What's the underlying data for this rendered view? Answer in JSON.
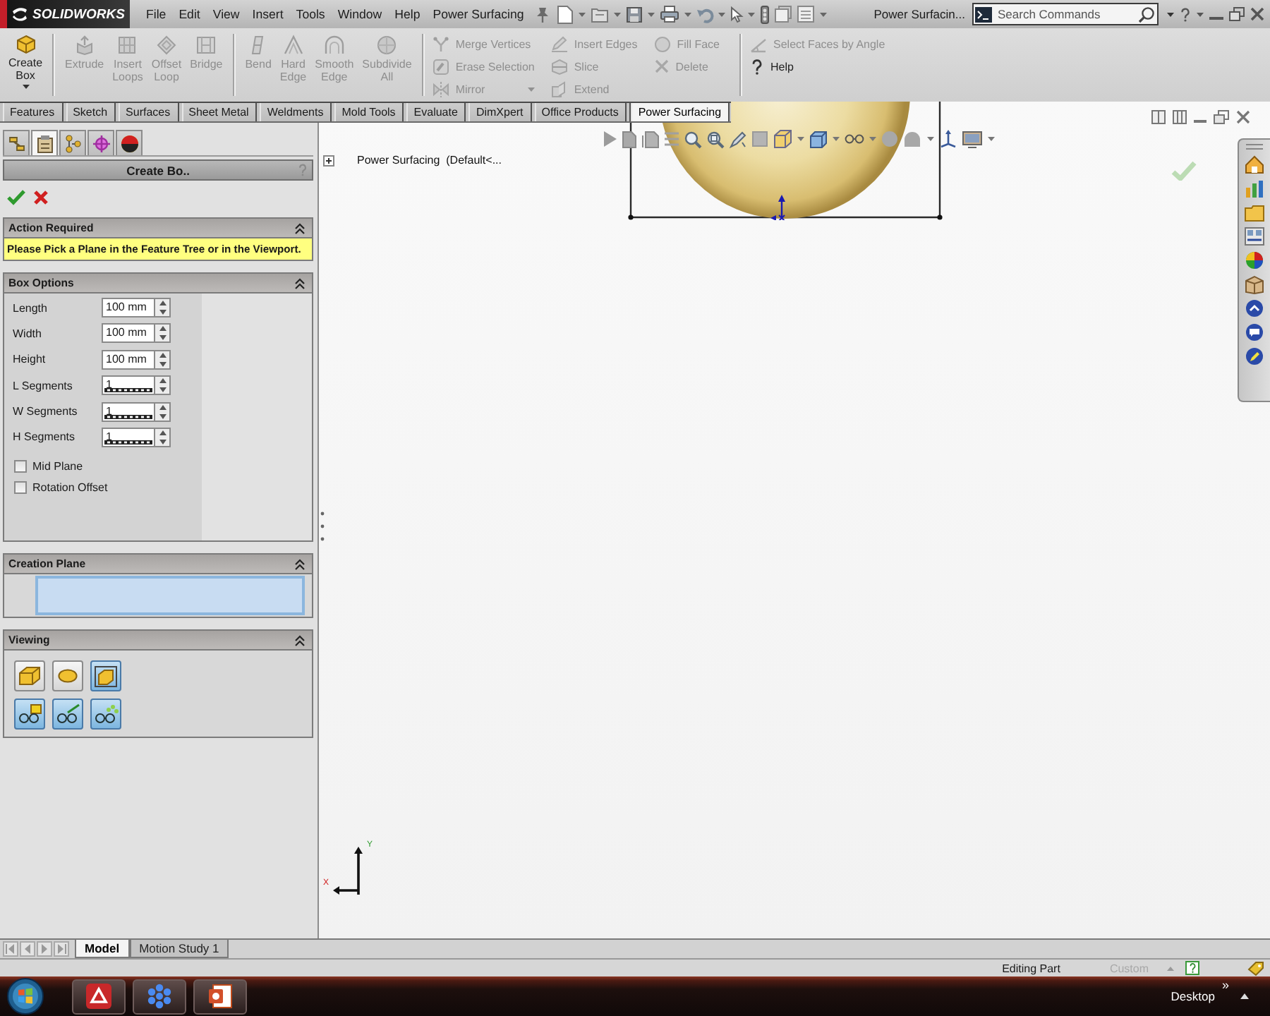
{
  "title_bar": {
    "logo": "SOLIDWORKS",
    "menu": [
      "File",
      "Edit",
      "View",
      "Insert",
      "Tools",
      "Window",
      "Help",
      "Power Surfacing"
    ],
    "document_title": "Power Surfacin...",
    "search": {
      "placeholder": "Search Commands"
    }
  },
  "ribbon": {
    "sections": [
      {
        "kind": "large",
        "items": [
          {
            "label": "Create Box",
            "disabled": false,
            "dropdown": true
          }
        ]
      },
      {
        "kind": "large",
        "items": [
          {
            "label": "Extrude",
            "disabled": true
          },
          {
            "label": "Insert Loops",
            "disabled": true
          },
          {
            "label": "Offset Loop",
            "disabled": true
          },
          {
            "label": "Bridge",
            "disabled": true
          }
        ]
      },
      {
        "kind": "large",
        "items": [
          {
            "label": "Bend",
            "disabled": true
          },
          {
            "label": "Hard Edge",
            "disabled": true
          },
          {
            "label": "Smooth Edge",
            "disabled": true
          },
          {
            "label": "Subdivide All",
            "disabled": true
          }
        ]
      },
      {
        "kind": "small",
        "columns": [
          [
            {
              "label": "Merge Vertices",
              "disabled": true
            },
            {
              "label": "Erase Selection",
              "disabled": true
            },
            {
              "label": "Mirror",
              "disabled": true,
              "dropdown": true
            }
          ],
          [
            {
              "label": "Insert Edges",
              "disabled": true
            },
            {
              "label": "Slice",
              "disabled": true
            },
            {
              "label": "Extend",
              "disabled": true
            }
          ],
          [
            {
              "label": "Fill Face",
              "disabled": true
            },
            {
              "label": "Delete",
              "disabled": true
            }
          ]
        ]
      },
      {
        "kind": "small",
        "columns": [
          [
            {
              "label": "Select Faces by Angle",
              "disabled": true
            },
            {
              "label": "Help",
              "disabled": false
            }
          ]
        ]
      }
    ]
  },
  "command_tabs": [
    {
      "label": "Features",
      "selected": false
    },
    {
      "label": "Sketch",
      "selected": false
    },
    {
      "label": "Surfaces",
      "selected": false
    },
    {
      "label": "Sheet Metal",
      "selected": false
    },
    {
      "label": "Weldments",
      "selected": false
    },
    {
      "label": "Mold Tools",
      "selected": false
    },
    {
      "label": "Evaluate",
      "selected": false
    },
    {
      "label": "DimXpert",
      "selected": false
    },
    {
      "label": "Office Products",
      "selected": false
    },
    {
      "label": "Power Surfacing",
      "selected": true
    }
  ],
  "property_manager": {
    "tabs": [
      {
        "selected": false
      },
      {
        "selected": true
      },
      {
        "selected": false
      },
      {
        "selected": false
      },
      {
        "selected": false
      }
    ],
    "title": "Create Bo..",
    "groups": [
      {
        "kind": "message",
        "title": "Action Required",
        "expanded": true,
        "message": "Please Pick a Plane in the Feature Tree or in the Viewport."
      },
      {
        "kind": "options",
        "title": "Box Options",
        "expanded": true,
        "fields": [
          {
            "kind": "measure",
            "label": "Length",
            "value": "100 mm"
          },
          {
            "kind": "measure",
            "label": "Width",
            "value": "100 mm"
          },
          {
            "kind": "measure",
            "label": "Height",
            "value": "100 mm"
          },
          {
            "kind": "count",
            "label": "L Segments",
            "value": "1"
          },
          {
            "kind": "count",
            "label": "W Segments",
            "value": "1"
          },
          {
            "kind": "count",
            "label": "H Segments",
            "value": "1"
          }
        ],
        "checkboxes": [
          {
            "label": "Mid Plane",
            "checked": false
          },
          {
            "label": "Rotation Offset",
            "checked": false
          }
        ]
      },
      {
        "kind": "selection",
        "title": "Creation Plane",
        "expanded": true,
        "active": true
      },
      {
        "kind": "view_buttons",
        "title": "Viewing",
        "expanded": true,
        "buttons": [
          {
            "selected": false
          },
          {
            "selected": false
          },
          {
            "selected": true
          },
          {
            "selected": true
          },
          {
            "selected": true
          },
          {
            "selected": true
          }
        ]
      }
    ]
  },
  "viewport": {
    "feature_tree": {
      "label": "Power Surfacing  (Default<...",
      "expanded": false
    },
    "triad": {
      "y_label": "Y",
      "x_label": "X"
    }
  },
  "bottom_tabs": [
    {
      "label": "Model",
      "selected": true
    },
    {
      "label": "Motion Study 1",
      "selected": false
    }
  ],
  "status_bar": {
    "mode": "Editing Part",
    "units": {
      "label": "Custom",
      "disabled": true
    }
  },
  "taskbar": {
    "toolbar": "Desktop",
    "overflow": "»"
  }
}
